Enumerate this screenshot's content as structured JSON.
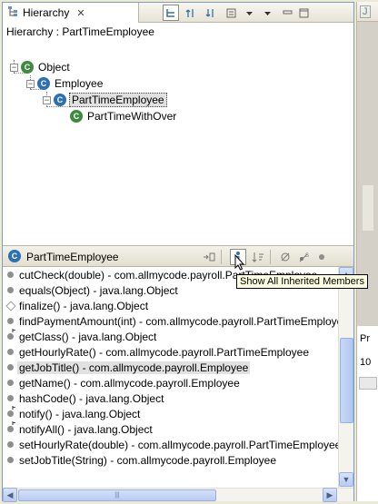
{
  "view": {
    "tab_title": "Hierarchy",
    "breadcrumb": "Hierarchy : PartTimeEmployee"
  },
  "tree": {
    "nodes": [
      {
        "label": "Object",
        "icon": "class-icon"
      },
      {
        "label": "Employee",
        "icon": "abstract-class-icon"
      },
      {
        "label": "PartTimeEmployee",
        "icon": "abstract-class-icon",
        "selected": true
      },
      {
        "label": "PartTimeWithOver",
        "icon": "class-icon"
      }
    ]
  },
  "members": {
    "title": "PartTimeEmployee",
    "items": [
      {
        "label": "cutCheck(double) - com.allmycode.payroll.PartTimeEmployee",
        "kind": "public"
      },
      {
        "label": "equals(Object) - java.lang.Object",
        "kind": "public"
      },
      {
        "label": "finalize() - java.lang.Object",
        "kind": "protected"
      },
      {
        "label": "findPaymentAmount(int) - com.allmycode.payroll.PartTimeEmployee",
        "kind": "public"
      },
      {
        "label": "getClass() - java.lang.Object",
        "kind": "public-final"
      },
      {
        "label": "getHourlyRate() - com.allmycode.payroll.PartTimeEmployee",
        "kind": "public"
      },
      {
        "label": "getJobTitle() - com.allmycode.payroll.Employee",
        "kind": "public",
        "selected": true
      },
      {
        "label": "getName() - com.allmycode.payroll.Employee",
        "kind": "public"
      },
      {
        "label": "hashCode() - java.lang.Object",
        "kind": "public"
      },
      {
        "label": "notify() - java.lang.Object",
        "kind": "public-final"
      },
      {
        "label": "notifyAll() - java.lang.Object",
        "kind": "public-final"
      },
      {
        "label": "setHourlyRate(double) - com.allmycode.payroll.PartTimeEmployee",
        "kind": "public"
      },
      {
        "label": "setJobTitle(String) - com.allmycode.payroll.Employee",
        "kind": "public"
      }
    ]
  },
  "tooltip": "Show All Inherited Members",
  "right_pane": {
    "tab_icon": "J",
    "text_pr": "Pr",
    "text_10": "10"
  }
}
